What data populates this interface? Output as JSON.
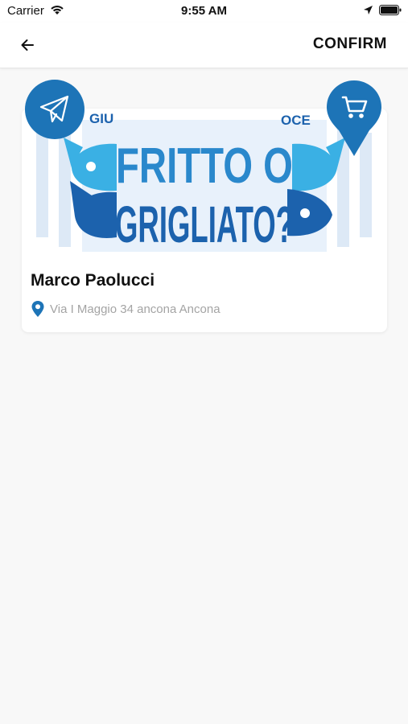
{
  "status_bar": {
    "carrier": "Carrier",
    "time": "9:55 AM"
  },
  "nav": {
    "confirm_label": "CONFIRM",
    "back_icon": "arrow-left-icon"
  },
  "banner": {
    "line1": "FRITTO O",
    "line2": "GRIGLIATO?",
    "arc_text": "GIUSTO ... DOCE"
  },
  "shop": {
    "name": "Marco Paolucci",
    "address": "Via I Maggio 34 ancona Ancona"
  },
  "colors": {
    "accent": "#1d74b7",
    "banner_dark_blue": "#1c62ad",
    "banner_light_blue": "#3ab0e4"
  },
  "icons": {
    "share": "paper-plane-icon",
    "cart": "shopping-cart-icon",
    "pin": "location-pin-icon"
  }
}
